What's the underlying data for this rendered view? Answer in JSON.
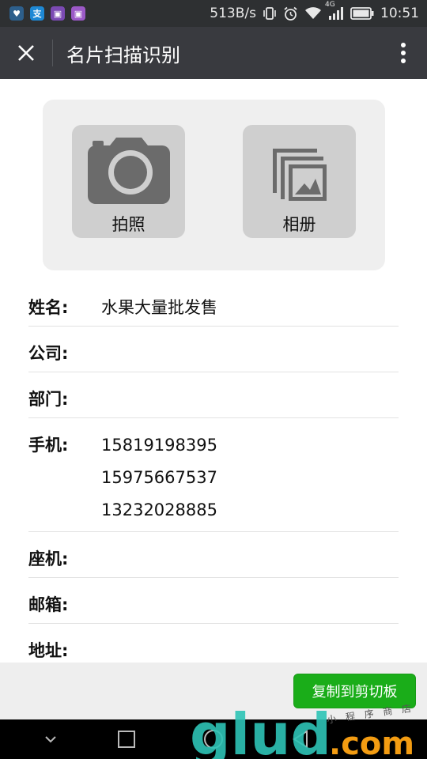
{
  "status_bar": {
    "net_speed": "513B/s",
    "signal_label": "4G",
    "time": "10:51",
    "app_icons": [
      "heart-app-icon",
      "alipay-icon",
      "gallery-icon",
      "gallery-icon"
    ]
  },
  "title_bar": {
    "title": "名片扫描识别"
  },
  "source_buttons": {
    "camera_label": "拍照",
    "album_label": "相册"
  },
  "fields": {
    "name": {
      "label": "姓名:",
      "value": "水果大量批发售"
    },
    "company": {
      "label": "公司:",
      "value": ""
    },
    "department": {
      "label": "部门:",
      "value": ""
    },
    "mobile": {
      "label": "手机:",
      "values": [
        "15819198395",
        "15975667537",
        "13232028885"
      ]
    },
    "landline": {
      "label": "座机:",
      "value": ""
    },
    "email": {
      "label": "邮箱:",
      "value": ""
    },
    "address": {
      "label": "地址:",
      "value": ""
    }
  },
  "actions": {
    "copy_label": "复制到剪切板"
  },
  "watermark": {
    "brand": "glud.com",
    "tagline": "小 程 序 商 店"
  },
  "colors": {
    "status_bg": "#2e3032",
    "title_bg": "#393a3f",
    "accent_green": "#1aad19",
    "watermark_teal": "#2ec4b6",
    "watermark_orange": "#f39c12"
  }
}
